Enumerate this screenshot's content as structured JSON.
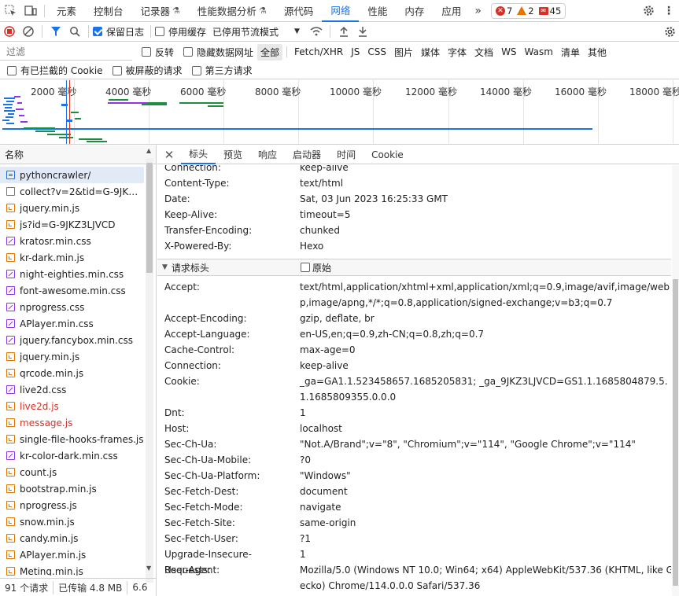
{
  "main_tabs": [
    {
      "label": "元素",
      "active": false
    },
    {
      "label": "控制台",
      "active": false
    },
    {
      "label": "记录器",
      "active": false,
      "flask": true
    },
    {
      "label": "性能数据分析",
      "active": false,
      "flask": true
    },
    {
      "label": "源代码",
      "active": false
    },
    {
      "label": "网络",
      "active": true
    },
    {
      "label": "性能",
      "active": false
    },
    {
      "label": "内存",
      "active": false
    },
    {
      "label": "应用",
      "active": false
    }
  ],
  "counters": {
    "errors": "7",
    "warnings": "2",
    "messages": "45"
  },
  "toolbar": {
    "preserve_log": "保留日志",
    "disable_cache": "停用缓存",
    "throttling": "已停用节流模式"
  },
  "filter": {
    "placeholder": "过滤",
    "invert": "反转",
    "hide_data_urls": "隐藏数据网址",
    "types": [
      "全部",
      "Fetch/XHR",
      "JS",
      "CSS",
      "图片",
      "媒体",
      "字体",
      "文档",
      "WS",
      "Wasm",
      "清单",
      "其他"
    ],
    "blocked_cookies": "有已拦截的 Cookie",
    "blocked_requests": "被屏蔽的请求",
    "third_party": "第三方请求"
  },
  "timeline": {
    "tick_labels": [
      "2000 毫秒",
      "4000 毫秒",
      "6000 毫秒",
      "8000 毫秒",
      "10000 毫秒",
      "12000 毫秒",
      "14000 毫秒",
      "16000 毫秒",
      "18000 毫秒"
    ]
  },
  "request_list": {
    "header": "名称",
    "items": [
      {
        "name": "pythoncrawler/",
        "type": "doc",
        "selected": true
      },
      {
        "name": "collect?v=2&tid=G-9JKZ3LJ...",
        "type": "other"
      },
      {
        "name": "jquery.min.js",
        "type": "js"
      },
      {
        "name": "js?id=G-9JKZ3LJVCD",
        "type": "js"
      },
      {
        "name": "kratosr.min.css",
        "type": "css"
      },
      {
        "name": "kr-dark.min.js",
        "type": "js"
      },
      {
        "name": "night-eighties.min.css",
        "type": "css"
      },
      {
        "name": "font-awesome.min.css",
        "type": "css"
      },
      {
        "name": "nprogress.css",
        "type": "css"
      },
      {
        "name": "APlayer.min.css",
        "type": "css"
      },
      {
        "name": "jquery.fancybox.min.css",
        "type": "css"
      },
      {
        "name": "jquery.min.js",
        "type": "js"
      },
      {
        "name": "qrcode.min.js",
        "type": "js"
      },
      {
        "name": "live2d.css",
        "type": "css"
      },
      {
        "name": "live2d.js",
        "type": "js",
        "error": true
      },
      {
        "name": "message.js",
        "type": "js",
        "error": true
      },
      {
        "name": "single-file-hooks-frames.js",
        "type": "js"
      },
      {
        "name": "kr-color-dark.min.css",
        "type": "css"
      },
      {
        "name": "count.js",
        "type": "js"
      },
      {
        "name": "bootstrap.min.js",
        "type": "js"
      },
      {
        "name": "nprogress.js",
        "type": "js"
      },
      {
        "name": "snow.min.js",
        "type": "js"
      },
      {
        "name": "candy.min.js",
        "type": "js"
      },
      {
        "name": "APlayer.min.js",
        "type": "js"
      },
      {
        "name": "Meting.min.js",
        "type": "js"
      }
    ],
    "status": {
      "requests": "91 个请求",
      "transferred": "已传输 4.8 MB",
      "resources": "6.6"
    }
  },
  "detail_tabs": [
    {
      "label": "标头",
      "active": true
    },
    {
      "label": "预览",
      "active": false
    },
    {
      "label": "响应",
      "active": false
    },
    {
      "label": "启动器",
      "active": false
    },
    {
      "label": "时间",
      "active": false
    },
    {
      "label": "Cookie",
      "active": false
    }
  ],
  "response_headers": [
    {
      "key": "Connection:",
      "value": "keep-alive"
    },
    {
      "key": "Content-Type:",
      "value": "text/html"
    },
    {
      "key": "Date:",
      "value": "Sat, 03 Jun 2023 16:25:33 GMT"
    },
    {
      "key": "Keep-Alive:",
      "value": "timeout=5"
    },
    {
      "key": "Transfer-Encoding:",
      "value": "chunked"
    },
    {
      "key": "X-Powered-By:",
      "value": "Hexo"
    }
  ],
  "request_section": {
    "title": "请求标头",
    "raw_label": "原始"
  },
  "request_headers": [
    {
      "key": "Accept:",
      "value": "text/html,application/xhtml+xml,application/xml;q=0.9,image/avif,image/webp,image/apng,*/*;q=0.8,application/signed-exchange;v=b3;q=0.7",
      "lines": 2
    },
    {
      "key": "Accept-Encoding:",
      "value": "gzip, deflate, br",
      "lines": 1
    },
    {
      "key": "Accept-Language:",
      "value": "en-US,en;q=0.9,zh-CN;q=0.8,zh;q=0.7",
      "lines": 1
    },
    {
      "key": "Cache-Control:",
      "value": "max-age=0",
      "lines": 1
    },
    {
      "key": "Connection:",
      "value": "keep-alive",
      "lines": 1
    },
    {
      "key": "Cookie:",
      "value": "_ga=GA1.1.523458657.1685205831; _ga_9JKZ3LJVCD=GS1.1.1685804879.5.1.1685809355.0.0.0",
      "lines": 2
    },
    {
      "key": "Dnt:",
      "value": "1",
      "lines": 1
    },
    {
      "key": "Host:",
      "value": "localhost",
      "lines": 1
    },
    {
      "key": "Sec-Ch-Ua:",
      "value": "\"Not.A/Brand\";v=\"8\", \"Chromium\";v=\"114\", \"Google Chrome\";v=\"114\"",
      "lines": 1
    },
    {
      "key": "Sec-Ch-Ua-Mobile:",
      "value": "?0",
      "lines": 1
    },
    {
      "key": "Sec-Ch-Ua-Platform:",
      "value": "\"Windows\"",
      "lines": 1
    },
    {
      "key": "Sec-Fetch-Dest:",
      "value": "document",
      "lines": 1
    },
    {
      "key": "Sec-Fetch-Mode:",
      "value": "navigate",
      "lines": 1
    },
    {
      "key": "Sec-Fetch-Site:",
      "value": "same-origin",
      "lines": 1
    },
    {
      "key": "Sec-Fetch-User:",
      "value": "?1",
      "lines": 1
    },
    {
      "key": "Upgrade-Insecure-Requests:",
      "value": "1",
      "lines": 1
    },
    {
      "key": "User-Agent:",
      "value": "Mozilla/5.0 (Windows NT 10.0; Win64; x64) AppleWebKit/537.36 (KHTML, like Gecko) Chrome/114.0.0.0 Safari/537.36",
      "lines": 2
    }
  ],
  "colors": {
    "accent": "#1a73e8",
    "error": "#d93025",
    "warning": "#e37400",
    "timeline_blue": "#1a73e8",
    "timeline_green": "#1e8e3e",
    "timeline_purple": "#9334e6"
  }
}
